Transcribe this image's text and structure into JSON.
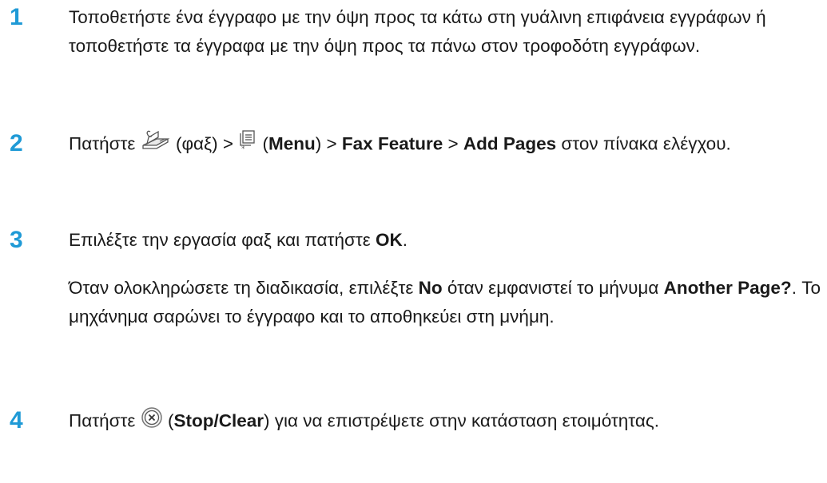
{
  "steps": [
    {
      "number": "1",
      "text": "Τοποθετήστε ένα έγγραφο με την όψη προς τα κάτω στη γυάλινη επιφάνεια εγγράφων ή τοποθετήστε τα έγγραφα με την όψη προς τα πάνω στον τροφοδότη εγγράφων."
    },
    {
      "number": "2",
      "t1": "Πατήστε ",
      "t2": " (φαξ) > ",
      "t3": " (",
      "menu": "Menu",
      "t4": ") > ",
      "fax_feature": "Fax Feature",
      "t5": " > ",
      "add_pages": "Add Pages",
      "t6": " στον πίνακα ελέγχου.",
      "fax_icon": "fax-icon",
      "menu_icon": "menu-icon"
    },
    {
      "number": "3",
      "t1": "Επιλέξτε την εργασία φαξ και πατήστε ",
      "ok": "OK",
      "t2": ".",
      "note_t1": "Όταν ολοκληρώσετε τη διαδικασία, επιλέξτε ",
      "no": "No",
      "note_t2": " όταν εμφανιστεί το μήνυμα ",
      "another_page": "Another Page?",
      "note_t3": ". Το μηχάνημα σαρώνει το έγγραφο και το αποθηκεύει στη μνήμη."
    },
    {
      "number": "4",
      "t1": "Πατήστε ",
      "t2": " (",
      "stop_clear": "Stop/Clear",
      "t3": ") για να επιστρέψετε στην κατάσταση ετοιμότητας.",
      "stop_icon": "stop-clear-icon"
    }
  ],
  "colors": {
    "step_number": "#1f9ad6",
    "text": "#1a1a1a"
  }
}
